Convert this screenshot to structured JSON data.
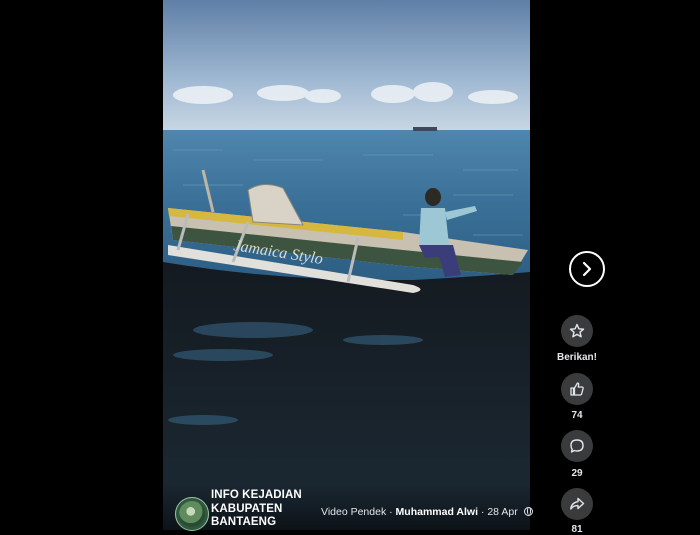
{
  "video": {
    "boat_text": "Jamaica Stylo"
  },
  "post": {
    "page_name": "INFO KEJADIAN KABUPATEN BANTAENG",
    "type_label": "Video Pendek",
    "separator": "·",
    "author": "Muhammad Alwi",
    "date": "28 Apr",
    "audience_icon": "globe-icon"
  },
  "navigation": {
    "next_icon": "chevron-right-icon"
  },
  "actions": {
    "give_star": {
      "label": "Berikan!",
      "icon": "star-icon"
    },
    "like": {
      "count": "74",
      "icon": "thumbs-up-icon"
    },
    "comment": {
      "count": "29",
      "icon": "comment-icon"
    },
    "share": {
      "count": "81",
      "icon": "share-icon"
    }
  },
  "colors": {
    "background": "#000000",
    "button_bg": "#3a3b3c",
    "text": "#e4e6eb"
  }
}
